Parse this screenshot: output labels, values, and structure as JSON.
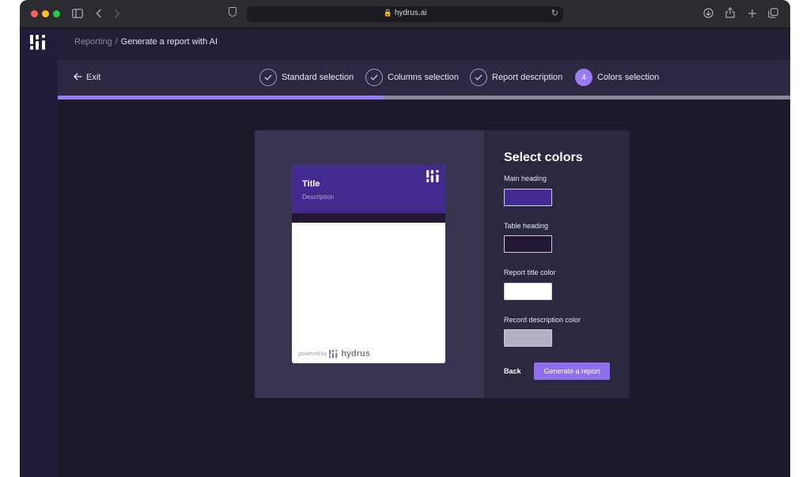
{
  "browser": {
    "url": "hydrus.ai",
    "icons": [
      "sidebar-toggle-icon",
      "back-icon",
      "forward-icon",
      "shield-icon",
      "lock-icon",
      "reload-icon",
      "download-icon",
      "share-icon",
      "new-tab-icon",
      "tabs-icon"
    ]
  },
  "header": {
    "breadcrumb_parent": "Reporting",
    "breadcrumb_separator": "/",
    "breadcrumb_current": "Generate a report with AI"
  },
  "stepper": {
    "exit_label": "Exit",
    "steps": [
      {
        "label": "Standard selection",
        "state": "done"
      },
      {
        "label": "Columns selection",
        "state": "done"
      },
      {
        "label": "Report description",
        "state": "done"
      },
      {
        "label": "Colors selection",
        "state": "active",
        "number": "4"
      }
    ],
    "progress_fraction": 0.445
  },
  "preview": {
    "title": "Title",
    "description": "Description",
    "powered_by": "powered by",
    "brand": "hydrus"
  },
  "colors_panel": {
    "title": "Select colors",
    "fields": [
      {
        "label": "Main heading",
        "color": "#422a8e"
      },
      {
        "label": "Table heading",
        "color": "#241636"
      },
      {
        "label": "Report title color",
        "color": "#ffffff"
      },
      {
        "label": "Record description color",
        "color": "#b3b0c2"
      }
    ],
    "back_label": "Back",
    "generate_label": "Generate a report"
  },
  "theme": {
    "accent": "#9a7cf2",
    "background": "#1e1a2d"
  }
}
